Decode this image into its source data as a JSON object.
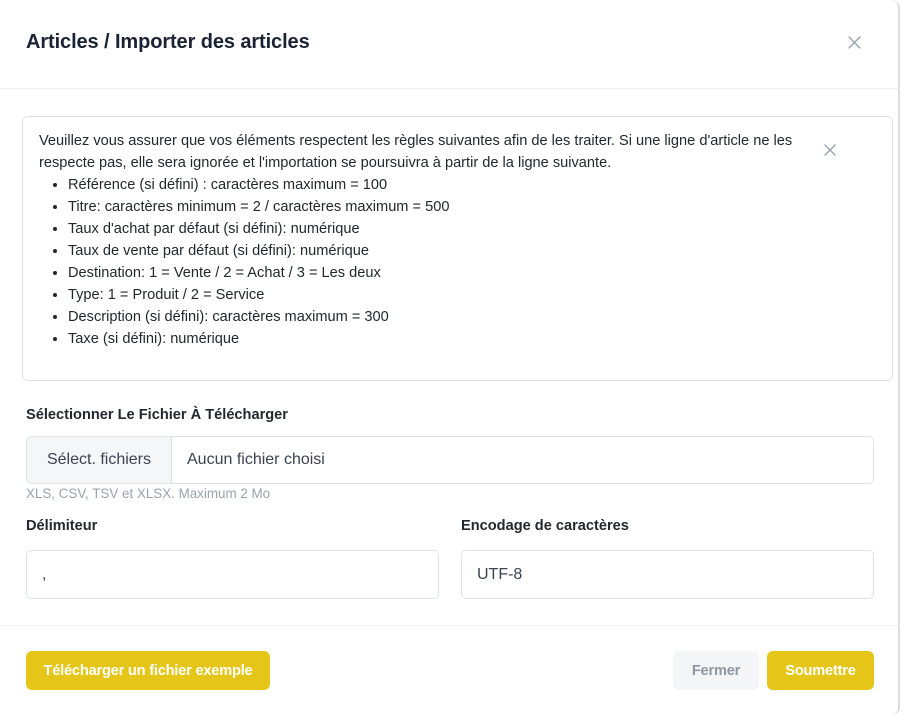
{
  "modal": {
    "title": "Articles / Importer des articles"
  },
  "alert": {
    "intro": "Veuillez vous assurer que vos éléments respectent les règles suivantes afin de les traiter. Si une ligne d'article ne les respecte pas, elle sera ignorée et l'importation se poursuivra à partir de la ligne suivante.",
    "rules": [
      "Référence (si défini) : caractères maximum = 100",
      "Titre: caractères minimum = 2 / caractères maximum = 500",
      "Taux d'achat par défaut (si défini): numérique",
      "Taux de vente par défaut (si défini): numérique",
      "Destination: 1 = Vente / 2 = Achat / 3 = Les deux",
      "Type: 1 = Produit / 2 = Service",
      "Description (si défini): caractères maximum = 300",
      "Taxe (si défini): numérique"
    ]
  },
  "upload": {
    "label": "Sélectionner Le Fichier À Télécharger",
    "button_label": "Sélect. fichiers",
    "file_name": "Aucun fichier choisi",
    "help": "XLS, CSV, TSV et XLSX. Maximum 2 Mo"
  },
  "delimiter": {
    "label": "Délimiteur",
    "value": ","
  },
  "encoding": {
    "label": "Encodage de caractères",
    "value": "UTF-8"
  },
  "footer": {
    "download_sample_label": "Télécharger un fichier exemple",
    "close_label": "Fermer",
    "submit_label": "Soumettre"
  },
  "colors": {
    "accent": "#e5c618",
    "title": "#1a2233",
    "border": "#dfe3e8",
    "muted_text": "#9aa1ad"
  },
  "icons": {
    "modal_close": "close-icon",
    "alert_close": "close-icon"
  }
}
